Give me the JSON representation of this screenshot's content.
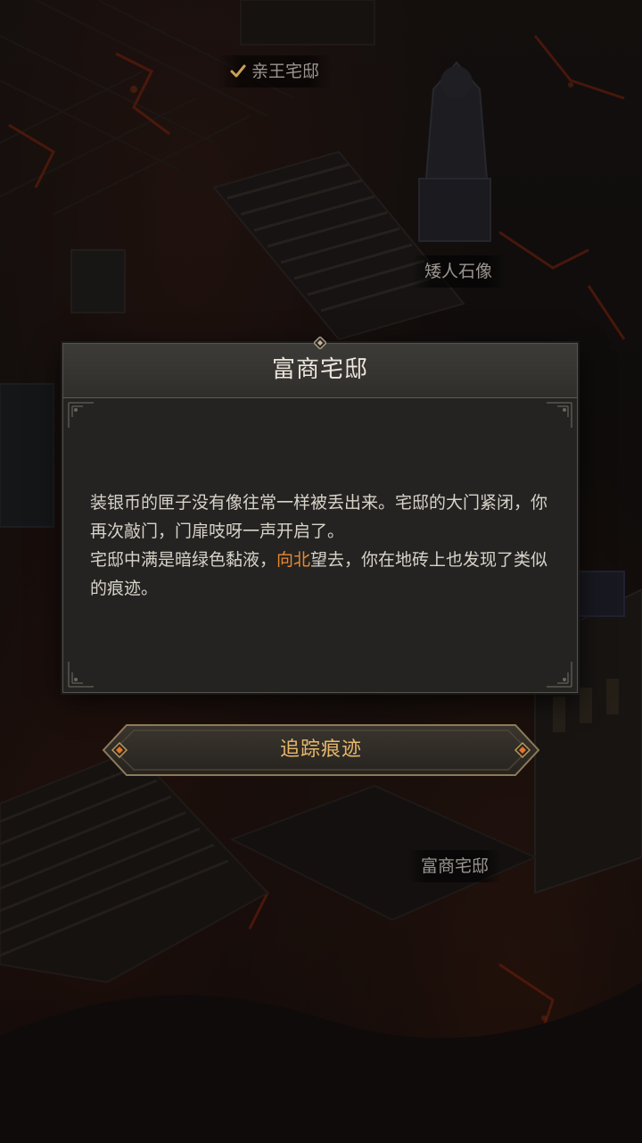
{
  "map": {
    "labels": {
      "prince_mansion": "亲王宅邸",
      "dwarf_statue": "矮人石像",
      "merchant_mansion": "富商宅邸"
    },
    "prince_mansion_visited": true
  },
  "dialog": {
    "title": "富商宅邸",
    "paragraph1": "装银币的匣子没有像往常一样被丢出来。宅邸的大门紧闭，你再次敲门，门扉吱呀一声开启了。",
    "paragraph2_before": "宅邸中满是暗绿色黏液，",
    "paragraph2_highlight": "向北",
    "paragraph2_after": "望去，你在地砖上也发现了类似的痕迹。"
  },
  "actions": {
    "track_label": "追踪痕迹"
  },
  "colors": {
    "highlight": "#e8892f",
    "button_text": "#e7b86a",
    "lava": "#8a2a12"
  },
  "icons": {
    "visited": "check-icon",
    "button_ornament": "diamond-gem-icon"
  }
}
